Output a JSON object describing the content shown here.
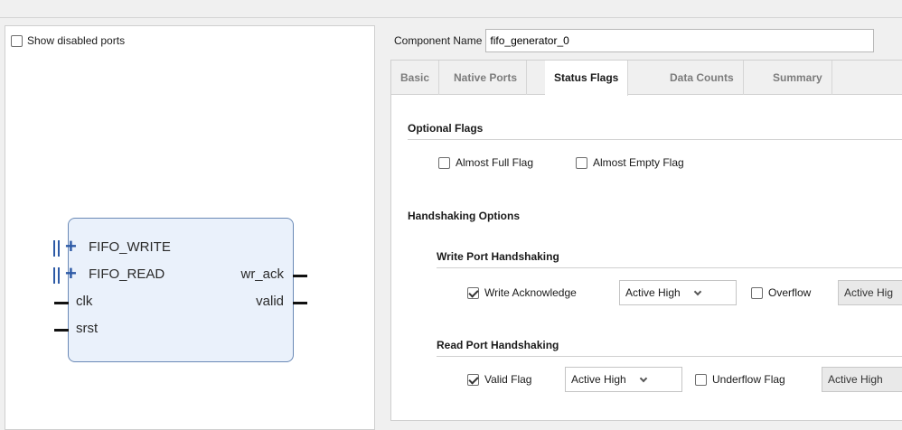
{
  "left": {
    "show_disabled_ports": "Show disabled ports",
    "block": {
      "ports_left": [
        "FIFO_WRITE",
        "FIFO_READ",
        "clk",
        "srst"
      ],
      "ports_right": [
        "wr_ack",
        "valid"
      ]
    }
  },
  "right": {
    "component_name_label": "Component Name",
    "component_name_value": "fifo_generator_0",
    "tabs": [
      "Basic",
      "Native Ports",
      "Status Flags",
      "Data Counts",
      "Summary"
    ],
    "active_tab": "Status Flags",
    "optional_flags": {
      "title": "Optional Flags",
      "almost_full": "Almost Full Flag",
      "almost_empty": "Almost Empty Flag"
    },
    "handshaking": {
      "title": "Handshaking Options",
      "write_title": "Write Port Handshaking",
      "write_ack": "Write Acknowledge",
      "write_ack_select": "Active High",
      "overflow": "Overflow",
      "overflow_select": "Active Hig",
      "read_title": "Read Port Handshaking",
      "valid_flag": "Valid Flag",
      "valid_select": "Active High",
      "underflow": "Underflow Flag",
      "underflow_select": "Active High"
    }
  }
}
